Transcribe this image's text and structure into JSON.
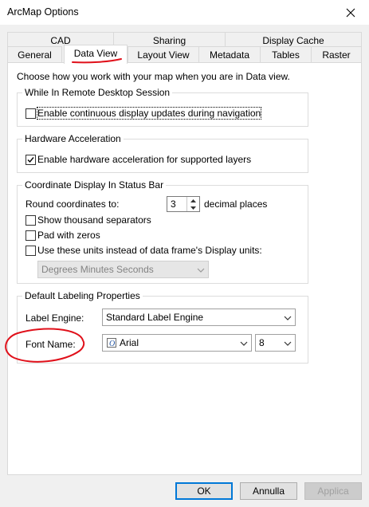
{
  "window": {
    "title": "ArcMap Options"
  },
  "tabs_row1": [
    "CAD",
    "Sharing",
    "Display Cache"
  ],
  "tabs_row2": [
    "General",
    "Data View",
    "Layout View",
    "Metadata",
    "Tables",
    "Raster"
  ],
  "active_tab": "Data View",
  "intro_text": "Choose how you work with your map when you are in Data view.",
  "remote_desktop": {
    "legend": "While In Remote Desktop Session",
    "checkbox_label": "Enable continuous display updates during navigation",
    "checked": false
  },
  "hardware_accel": {
    "legend": "Hardware Acceleration",
    "checkbox_label": "Enable hardware acceleration for supported layers",
    "checked": true
  },
  "coordinate_display": {
    "legend": "Coordinate Display In Status Bar",
    "round_label": "Round coordinates to:",
    "round_value": "3",
    "decimal_label": "decimal places",
    "thousand_label": "Show thousand separators",
    "pad_label": "Pad with zeros",
    "use_units_label": "Use these units instead of data frame's Display units:",
    "units_value": "Degrees Minutes Seconds"
  },
  "labeling": {
    "legend": "Default Labeling Properties",
    "engine_label": "Label Engine:",
    "engine_value": "Standard Label Engine",
    "font_label": "Font Name:",
    "font_value": "Arial",
    "size_value": "8"
  },
  "buttons": {
    "ok": "OK",
    "cancel": "Annulla",
    "apply": "Applica"
  },
  "colors": {
    "accent": "#0078d7",
    "annotation": "#e0101a"
  }
}
